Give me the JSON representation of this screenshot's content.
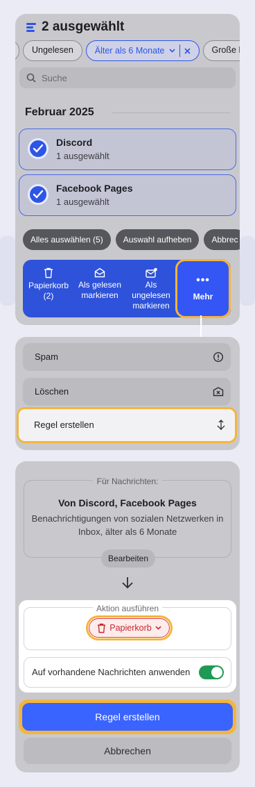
{
  "header": {
    "title": "2 ausgewählt"
  },
  "filters": [
    {
      "label": "Ungelesen"
    },
    {
      "label": "Älter als 6 Monate",
      "active": true
    },
    {
      "label": "Große E-M"
    }
  ],
  "search": {
    "placeholder": "Suche"
  },
  "month": "Februar 2025",
  "senders": [
    {
      "name": "Discord",
      "count": "1 ausgewählt"
    },
    {
      "name": "Facebook Pages",
      "count": "1 ausgewählt"
    }
  ],
  "selection_actions": [
    "Alles auswählen (5)",
    "Auswahl aufheben",
    "Abbrec"
  ],
  "actionbar": {
    "trash": "Papierkorb (2)",
    "mark_read": "Als gelesen markieren",
    "mark_unread": "Als ungelesen markieren",
    "more": "Mehr"
  },
  "more_menu": {
    "spam": "Spam",
    "delete": "Löschen",
    "create_rule": "Regel erstellen"
  },
  "rule": {
    "for_label": "Für Nachrichten:",
    "from": "Von Discord, Facebook Pages",
    "description": "Benachrichtigungen von sozialen Netzwerken in Inbox, älter als 6 Monate",
    "edit": "Bearbeiten",
    "action_label": "Aktion ausführen",
    "action_value": "Papierkorb",
    "apply_existing": "Auf vorhandene Nachrichten anwenden",
    "apply_existing_on": true,
    "create": "Regel erstellen",
    "cancel": "Abbrechen"
  },
  "colors": {
    "accent": "#2d55e6",
    "highlight": "#f5b53b",
    "danger": "#c8282d",
    "toggle_on": "#1f9a55"
  }
}
